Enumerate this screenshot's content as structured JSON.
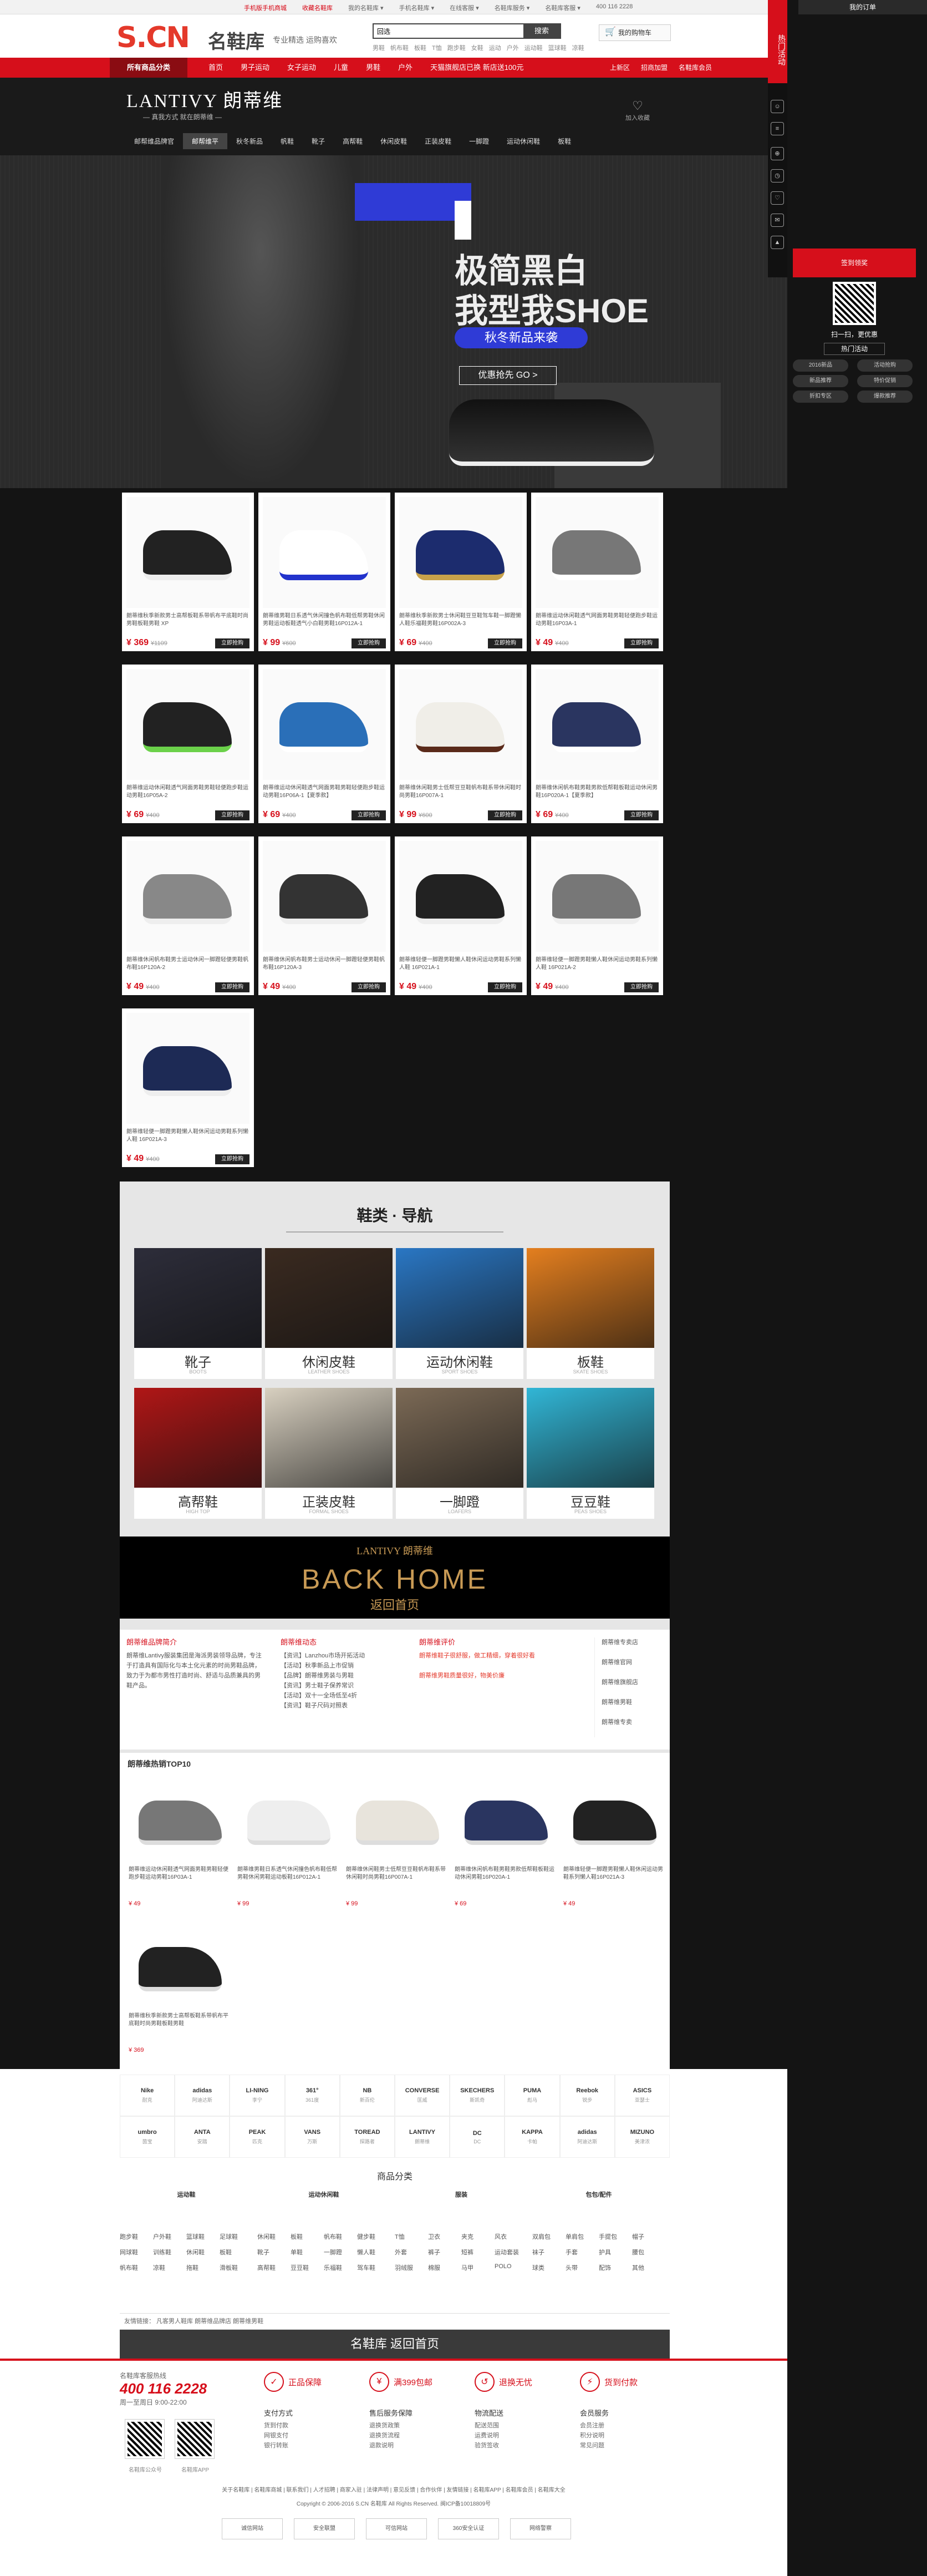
{
  "topbar": {
    "links": [
      "手机版手机商城",
      "收藏名鞋库",
      "我的名鞋库 ▾",
      "手机名鞋库 ▾",
      "在线客服 ▾",
      "名鞋库服务 ▾",
      "名鞋库客服 ▾",
      "400 116 2228"
    ]
  },
  "header": {
    "logo": "S.CN",
    "logo_cn": "名鞋库",
    "slogan": "专业精选 运购喜欢",
    "search_value": "回选",
    "search_button": "搜索",
    "hotwords": [
      "男鞋",
      "帆布鞋",
      "板鞋",
      "T恤",
      "跑步鞋",
      "女鞋",
      "运动",
      "户外",
      "运动鞋",
      "篮球鞋",
      "凉鞋"
    ],
    "cart": "我的购物车"
  },
  "nav": {
    "all": "所有商品分类",
    "items": [
      "首页",
      "男子运动",
      "女子运动",
      "儿童",
      "男鞋",
      "户外",
      "天猫旗舰店已换 新店送100元"
    ],
    "right": [
      "上新区",
      "招商加盟",
      "名鞋库会员"
    ]
  },
  "brand": {
    "logo": "LANTIVY 朗蒂维",
    "sub": "— 真我方式 就在朗蒂维 —",
    "fav": "加入收藏",
    "subnav": [
      "邮帮维品牌官",
      "邮帮维平",
      "秋冬新品",
      "帆鞋",
      "靴子",
      "高帮鞋",
      "休闲皮鞋",
      "正装皮鞋",
      "一脚蹬",
      "运动休闲鞋",
      "板鞋"
    ],
    "active": 1
  },
  "banner": {
    "title1": "极简黑白",
    "title2": "我型我SHOE",
    "pill": "秋冬新品来袭",
    "go": "优惠抢先 GO >"
  },
  "products": [
    {
      "name": "朗蒂维秋季新款男士高帮板鞋系带帆布平底鞋时尚男鞋板鞋男鞋 XP",
      "price": "¥ 369",
      "old": "¥1109",
      "buy": "立即抢购",
      "shoe": "#222",
      "trim": "#eee"
    },
    {
      "name": "朗蒂维男鞋日系透气休闲撞色帆布鞋低帮男鞋休闲男鞋运动板鞋透气小白鞋男鞋16P012A-1",
      "price": "¥ 99",
      "old": "¥600",
      "buy": "立即抢购",
      "shoe": "#fff",
      "trim": "#2233cc"
    },
    {
      "name": "朗蒂维秋季新款男士休闲鞋豆豆鞋驾车鞋一脚蹬懒人鞋乐福鞋男鞋16P002A-3",
      "price": "¥ 69",
      "old": "¥400",
      "buy": "立即抢购",
      "shoe": "#1c2c6e",
      "trim": "#c8a24a"
    },
    {
      "name": "朗蒂维运动休闲鞋透气网面男鞋男鞋轻便跑步鞋运动男鞋16P03A-1",
      "price": "¥ 49",
      "old": "¥400",
      "buy": "立即抢购",
      "shoe": "#777",
      "trim": "#fff"
    },
    {
      "name": "朗蒂维运动休闲鞋透气网面男鞋男鞋轻便跑步鞋运动男鞋16P05A-2 ",
      "price": "¥ 69",
      "old": "¥400",
      "buy": "立即抢购",
      "shoe": "#222",
      "trim": "#6bd14a"
    },
    {
      "name": "朗蒂维运动休闲鞋透气网面男鞋男鞋轻便跑步鞋运动男鞋16P06A-1【夏季款】",
      "price": "¥ 69",
      "old": "¥400",
      "buy": "立即抢购",
      "shoe": "#2a6fb8",
      "trim": "#fff"
    },
    {
      "name": "朗蒂维休闲鞋男士低帮豆豆鞋帆布鞋系带休闲鞋时尚男鞋16P007A-1",
      "price": "¥ 99",
      "old": "¥600",
      "buy": "立即抢购",
      "shoe": "#f0eee8",
      "trim": "#5a2a1a"
    },
    {
      "name": "朗蒂维休闲帆布鞋男鞋男款低帮鞋板鞋运动休闲男鞋16P020A-1【夏季款】",
      "price": "¥ 69",
      "old": "¥400",
      "buy": "立即抢购",
      "shoe": "#2a3560",
      "trim": "#fff"
    },
    {
      "name": "朗蒂维休闲帆布鞋男士运动休闲一脚蹬轻便男鞋帆布鞋16P120A-2",
      "price": "¥ 49",
      "old": "¥400",
      "buy": "立即抢购",
      "shoe": "#888",
      "trim": "#eee"
    },
    {
      "name": "朗蒂维休闲帆布鞋男士运动休闲一脚蹬轻便男鞋帆布鞋16P120A-3",
      "price": "¥ 49",
      "old": "¥400",
      "buy": "立即抢购",
      "shoe": "#333",
      "trim": "#eee"
    },
    {
      "name": "朗蒂维轻便一脚蹬男鞋懒人鞋休闲运动男鞋系列懒人鞋 16P021A-1",
      "price": "¥ 49",
      "old": "¥400",
      "buy": "立即抢购",
      "shoe": "#222",
      "trim": "#eee"
    },
    {
      "name": "朗蒂维轻便一脚蹬男鞋懒人鞋休闲运动男鞋系列懒人鞋 16P021A-2",
      "price": "¥ 49",
      "old": "¥400",
      "buy": "立即抢购",
      "shoe": "#777",
      "trim": "#eee"
    },
    {
      "name": "朗蒂维轻便一脚蹬男鞋懒人鞋休闲运动男鞋系列懒人鞋 16P021A-3",
      "price": "¥ 49",
      "old": "¥400",
      "buy": "立即抢购",
      "shoe": "#1d2a55",
      "trim": "#eee"
    }
  ],
  "category": {
    "title": "鞋类 · 导航",
    "items": [
      {
        "cn": "靴子",
        "en": "BOOTS",
        "bg": "#2d2d3a"
      },
      {
        "cn": "休闲皮鞋",
        "en": "LEATHER SHOES",
        "bg": "#3a2a20"
      },
      {
        "cn": "运动休闲鞋",
        "en": "SPORT SHOES",
        "bg": "#2a77c4"
      },
      {
        "cn": "板鞋",
        "en": "SKATE SHOES",
        "bg": "#e47f1f"
      },
      {
        "cn": "高帮鞋",
        "en": "HIGH TOP",
        "bg": "#b01616"
      },
      {
        "cn": "正装皮鞋",
        "en": "FORMAL SHOES",
        "bg": "#d8d0c0"
      },
      {
        "cn": "一脚蹬",
        "en": "LOAFERS",
        "bg": "#7c6a56"
      },
      {
        "cn": "豆豆鞋",
        "en": "PEAS SHOES",
        "bg": "#31b6d6"
      }
    ]
  },
  "backhome": {
    "logo": "LANTIVY 朗蒂维",
    "title": "BACK HOME",
    "sub": "返回首页"
  },
  "info": {
    "intro_title": "朗蒂维品牌简介",
    "intro": "朗蒂维Lantivy服装集团是海派男装领导品牌，专注于打造具有国际化与本土化元素的时尚男鞋品牌，致力于为都市男性打造时尚、舒适与品质兼具的男鞋产品。",
    "news_title": "朗蒂维动态",
    "news": [
      "【资讯】Lanzhou市场开拓活动",
      "【活动】秋季新品上市促销",
      "【品牌】朗蒂维男装与男鞋",
      "【资讯】男士鞋子保养常识",
      "【活动】双十一全场低至4折",
      "【资讯】鞋子尺码对照表"
    ],
    "review_title": "朗蒂维评价",
    "reviews": [
      "朗蒂维鞋子很舒服，做工精细，穿着很好看",
      "朗蒂维男鞋质量很好，物美价廉"
    ],
    "links": [
      "朗蒂维专卖店",
      "朗蒂维官网",
      "朗蒂维旗舰店",
      "朗蒂维男鞋",
      "朗蒂维专卖"
    ]
  },
  "top10": {
    "title": "朗蒂维热销TOP10",
    "items": [
      {
        "name": "朗蒂维运动休闲鞋透气网面男鞋男鞋轻便跑步鞋运动男鞋16P03A-1",
        "price": "¥ 49",
        "shoe": "#777"
      },
      {
        "name": "朗蒂维男鞋日系透气休闲撞色帆布鞋低帮男鞋休闲男鞋运动板鞋16P012A-1",
        "price": "¥ 99",
        "shoe": "#eee"
      },
      {
        "name": "朗蒂维休闲鞋男士低帮豆豆鞋帆布鞋系带休闲鞋时尚男鞋16P007A-1",
        "price": "¥ 99",
        "shoe": "#e8e4dc"
      },
      {
        "name": "朗蒂维休闲帆布鞋男鞋男款低帮鞋板鞋运动休闲男鞋16P020A-1",
        "price": "¥ 69",
        "shoe": "#2a3560"
      },
      {
        "name": "朗蒂维轻便一脚蹬男鞋懒人鞋休闲运动男鞋系列懒人鞋16P021A-3",
        "price": "¥ 49",
        "shoe": "#222"
      },
      {
        "name": "朗蒂维秋季新款男士高帮板鞋系带帆布平底鞋时尚男鞋板鞋男鞋",
        "price": "¥ 369",
        "shoe": "#222"
      }
    ]
  },
  "brands": [
    {
      "n": "Nike",
      "c": "耐克"
    },
    {
      "n": "adidas",
      "c": "阿迪达斯"
    },
    {
      "n": "LI-NING",
      "c": "李宁"
    },
    {
      "n": "361°",
      "c": "361度"
    },
    {
      "n": "NB",
      "c": "新百伦"
    },
    {
      "n": "CONVERSE",
      "c": "匡威"
    },
    {
      "n": "SKECHERS",
      "c": "斯凯奇"
    },
    {
      "n": "PUMA",
      "c": "彪马"
    },
    {
      "n": "Reebok",
      "c": "锐步"
    },
    {
      "n": "ASICS",
      "c": "亚瑟士"
    },
    {
      "n": "umbro",
      "c": "茵宝"
    },
    {
      "n": "ANTA",
      "c": "安踏"
    },
    {
      "n": "PEAK",
      "c": "匹克"
    },
    {
      "n": "VANS",
      "c": "万斯"
    },
    {
      "n": "TOREAD",
      "c": "探路者"
    },
    {
      "n": "LANTIVY",
      "c": "朗蒂维"
    },
    {
      "n": "DC",
      "c": "DC"
    },
    {
      "n": "KAPPA",
      "c": "卡帕"
    },
    {
      "n": "adidas",
      "c": "阿迪达斯"
    },
    {
      "n": "MIZUNO",
      "c": "美津浓"
    }
  ],
  "cats": {
    "title": "商品分类",
    "groups": [
      {
        "h": "运动鞋",
        "items": [
          "跑步鞋",
          "户外鞋",
          "篮球鞋",
          "足球鞋",
          "网球鞋",
          "训练鞋",
          "休闲鞋",
          "板鞋",
          "帆布鞋",
          "凉鞋",
          "拖鞋",
          "滑板鞋"
        ]
      },
      {
        "h": "运动休闲鞋",
        "items": [
          "休闲鞋",
          "板鞋",
          "帆布鞋",
          "健步鞋",
          "靴子",
          "单鞋",
          "一脚蹬",
          "懒人鞋",
          "高帮鞋",
          "豆豆鞋",
          "乐福鞋",
          "驾车鞋"
        ]
      },
      {
        "h": "服装",
        "items": [
          "T恤",
          "卫衣",
          "夹克",
          "风衣",
          "外套",
          "裤子",
          "短裤",
          "运动套装",
          "羽绒服",
          "棉服",
          "马甲",
          "POLO"
        ]
      },
      {
        "h": "包包/配件",
        "items": [
          "双肩包",
          "单肩包",
          "手提包",
          "帽子",
          "袜子",
          "手套",
          "护具",
          "腰包",
          "球类",
          "头带",
          "配饰",
          "其他"
        ]
      }
    ]
  },
  "friend": "友情链接：   凡客男人鞋库   朗蒂维品牌店   朗蒂维男鞋",
  "return_bar": "名鞋库  返回首页",
  "footer": {
    "hotline_label": "名鞋库客服热线",
    "hotline": "400 116 2228",
    "hours": "周一至周日 9:00-22:00",
    "svc": [
      {
        "i": "✓",
        "t": "正品保障"
      },
      {
        "i": "¥",
        "t": "满399包邮"
      },
      {
        "i": "↺",
        "t": "退换无忧"
      },
      {
        "i": "⚡",
        "t": "货到付款"
      }
    ],
    "cols": [
      {
        "h": "支付方式",
        "items": [
          "货到付款",
          "网银支付",
          "银行转账"
        ]
      },
      {
        "h": "售后服务保障",
        "items": [
          "退换货政策",
          "退换货流程",
          "退款说明"
        ]
      },
      {
        "h": "物流配送",
        "items": [
          "配送范围",
          "运费说明",
          "验货签收"
        ]
      },
      {
        "h": "会员服务",
        "items": [
          "会员注册",
          "积分说明",
          "常见问题"
        ]
      }
    ],
    "qr1": "名鞋库公众号",
    "qr2": "名鞋库APP"
  },
  "bottom": {
    "links": "关于名鞋库 | 名鞋库商城 | 联系我们 | 人才招聘 | 商家入驻 | 法律声明 | 意见反馈 | 合作伙伴 | 友情链接 | 名鞋库APP | 名鞋库会员 | 名鞋库大全",
    "copy": "Copyright © 2006-2016 S.CN 名鞋库 All Rights Reserved. 闽ICP备10018809号",
    "badges": [
      "诚信网站",
      "安全联盟",
      "可信网站",
      "360安全认证",
      "网络警察"
    ]
  },
  "right": {
    "hot": "热门活动",
    "my_order": "我的订单",
    "signin": "签到领奖",
    "scan": "扫一扫，更优惠",
    "activity": "热门活动",
    "tags": [
      "2016新品",
      "活动抢购",
      "新品推荐",
      "特价促销",
      "折扣专区",
      "爆款推荐"
    ]
  }
}
